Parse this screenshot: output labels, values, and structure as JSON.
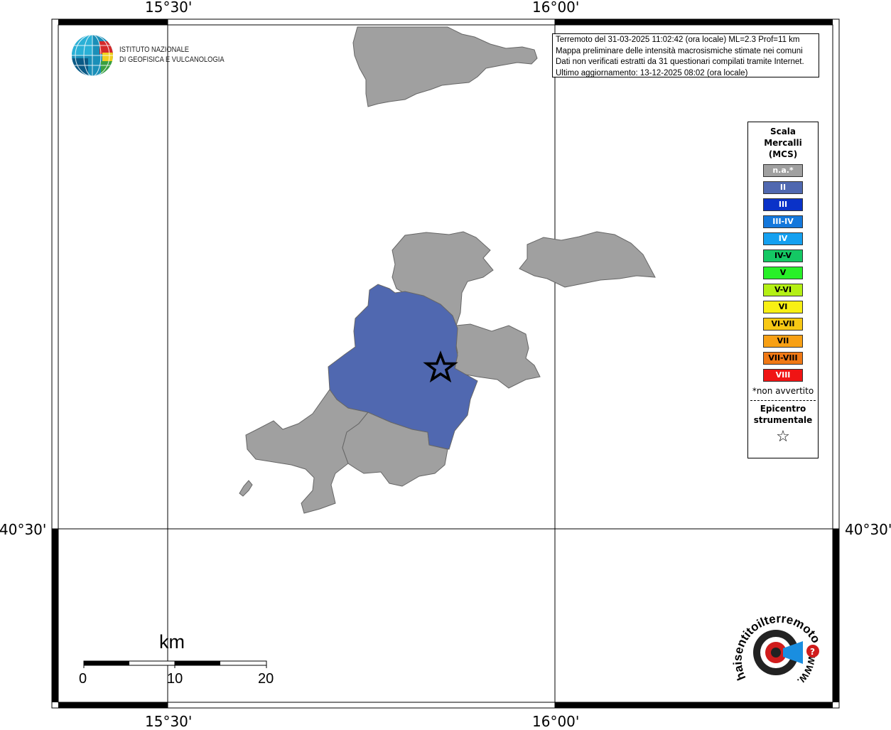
{
  "graticule": {
    "top_left": "15°30'",
    "top_right": "16°00'",
    "bottom_left": "15°30'",
    "bottom_right": "16°00'",
    "left_lat": "40°30'",
    "right_lat": "40°30'"
  },
  "logo": {
    "name_line1": "ISTITUTO NAZIONALE",
    "name_line2": "DI GEOFISICA E VULCANOLOGIA"
  },
  "info": {
    "line1": "Terremoto del 31-03-2025 11:02:42 (ora locale) ML=2.3 Prof=11 km",
    "line2": "Mappa preliminare delle intensità macrosismiche stimate nei comuni",
    "line3": "Dati non verificati estratti da 31 questionari compilati tramite Internet.",
    "line4": "Ultimo aggiornamento: 13-12-2025 08:02 (ora locale)"
  },
  "legend": {
    "title_line1": "Scala",
    "title_line2": "Mercalli",
    "title_line3": "(MCS)",
    "items": [
      {
        "label": "n.a.*",
        "color": "#a0a0a0",
        "text_color": "#ffffff"
      },
      {
        "label": "II",
        "color": "#5068b0",
        "text_color": "#ffffff"
      },
      {
        "label": "III",
        "color": "#0a32c8",
        "text_color": "#ffffff"
      },
      {
        "label": "III-IV",
        "color": "#1478dc",
        "text_color": "#ffffff"
      },
      {
        "label": "IV",
        "color": "#14a0f0",
        "text_color": "#ffffff"
      },
      {
        "label": "IV-V",
        "color": "#14c864",
        "text_color": "#000000"
      },
      {
        "label": "V",
        "color": "#28f028",
        "text_color": "#000000"
      },
      {
        "label": "V-VI",
        "color": "#b4f014",
        "text_color": "#000000"
      },
      {
        "label": "VI",
        "color": "#f8f014",
        "text_color": "#000000"
      },
      {
        "label": "VI-VII",
        "color": "#f8c814",
        "text_color": "#000000"
      },
      {
        "label": "VII",
        "color": "#f8a014",
        "text_color": "#000000"
      },
      {
        "label": "VII-VIII",
        "color": "#f07814",
        "text_color": "#000000"
      },
      {
        "label": "VIII",
        "color": "#f01414",
        "text_color": "#ffffff"
      }
    ],
    "note": "*non avvertito",
    "epicenter_line1": "Epicentro",
    "epicenter_line2": "strumentale",
    "epicenter_symbol": "☆"
  },
  "scale_bar": {
    "title": "km",
    "tick0": "0",
    "tick1": "10",
    "tick2": "20"
  },
  "hsit_logo": {
    "text": "haisentitoilterremoto.it",
    "www": "WWW."
  },
  "colors": {
    "land_unfelt": "#a0a0a0",
    "intensity_II": "#5068b0"
  }
}
